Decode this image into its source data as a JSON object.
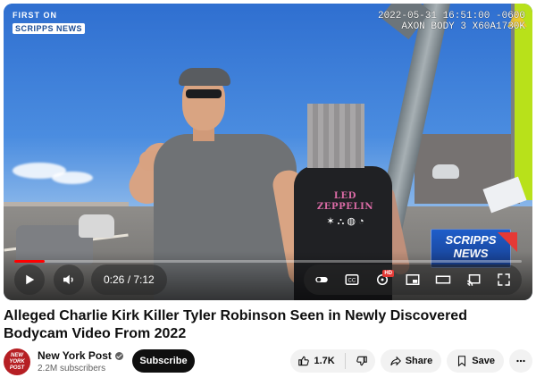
{
  "player": {
    "brand_top": "FIRST ON",
    "brand_bottom": "SCRIPPS NEWS",
    "meta_time": "2022-05-31 16:51:00 -0600",
    "meta_device": "AXON BODY 3 X60A1730K",
    "shirt_text": "LED ZEPPELIN",
    "shirt_symbols": "✶ ⛬ ◍ ◔",
    "overlay_top": "SCRIPPS",
    "overlay_bottom": "NEWS",
    "current_time": "0:26",
    "duration": "7:12",
    "time_display": "0:26 / 7:12",
    "progress_fraction": 0.06,
    "hd_badge": "HD",
    "icons": {
      "play": "play-icon",
      "volume": "volume-icon",
      "autoplay": "autoplay-icon",
      "captions": "captions-icon",
      "settings": "settings-icon",
      "miniplayer": "miniplayer-icon",
      "theater": "theater-icon",
      "cast": "cast-icon",
      "fullscreen": "fullscreen-icon"
    }
  },
  "video": {
    "title": "Alleged Charlie Kirk Killer Tyler Robinson Seen in Newly Discovered Bodycam Video From 2022"
  },
  "channel": {
    "avatar_text": "NEW YORK POST",
    "name": "New York Post",
    "subscribers": "2.2M subscribers",
    "subscribe_label": "Subscribe"
  },
  "actions": {
    "likes": "1.7K",
    "share": "Share",
    "save": "Save"
  },
  "colors": {
    "accent": "#ff0000",
    "subscribe_bg": "#0f0f0f",
    "pill_bg": "#f2f2f2"
  }
}
